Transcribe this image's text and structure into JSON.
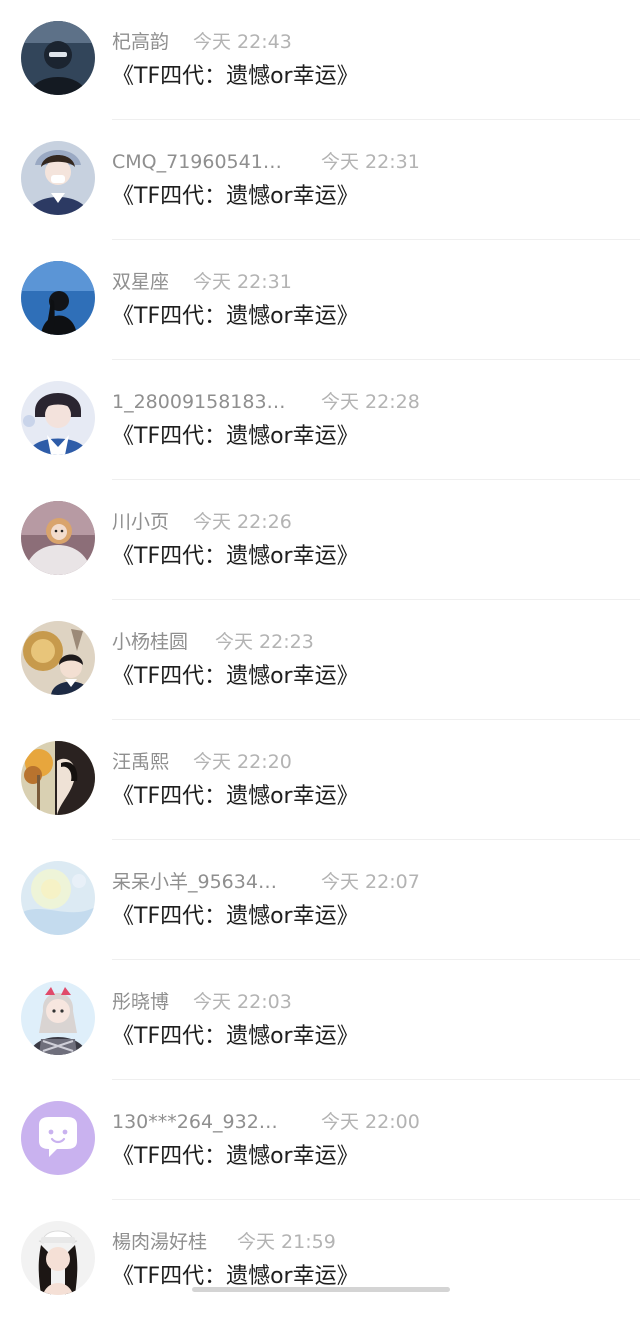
{
  "messages": [
    {
      "name": "杞高韵",
      "time": "今天 22:43",
      "text": "《TF四代：遗憾or幸运》",
      "avatar": "dark-masked-person"
    },
    {
      "name": "CMQ_71960541…",
      "time": "今天 22:31",
      "text": "《TF四代：遗憾or幸运》",
      "avatar": "girl-school-uniform"
    },
    {
      "name": "双星座",
      "time": "今天 22:31",
      "text": "《TF四代：遗憾or幸运》",
      "avatar": "silhouette-blue-sky"
    },
    {
      "name": "1_28009158183…",
      "time": "今天 22:28",
      "text": "《TF四代：遗憾or幸运》",
      "avatar": "boy-blue-white"
    },
    {
      "name": "川小页",
      "time": "今天 22:26",
      "text": "《TF四代：遗憾or幸运》",
      "avatar": "hooded-figure"
    },
    {
      "name": "小杨桂圆",
      "time": "今天 22:23",
      "text": "《TF四代：遗憾or幸运》",
      "avatar": "sun-drawing-boy"
    },
    {
      "name": "汪禹熙",
      "time": "今天 22:20",
      "text": "《TF四代：遗憾or幸运》",
      "avatar": "autumn-tree-girl"
    },
    {
      "name": "呆呆小羊_95634…",
      "time": "今天 22:07",
      "text": "《TF四代：遗憾or幸运》",
      "avatar": "pale-blue-pattern"
    },
    {
      "name": "彤晓博",
      "time": "今天 22:03",
      "text": "《TF四代：遗憾or幸运》",
      "avatar": "anime-girl-plaid"
    },
    {
      "name": "130***264_932…",
      "time": "今天 22:00",
      "text": "《TF四代：遗憾or幸运》",
      "avatar": "default-chat-bubble"
    },
    {
      "name": "楊肉湯好桂",
      "time": "今天 21:59",
      "text": "《TF四代：遗憾or幸运》",
      "avatar": "girl-white-cap"
    }
  ],
  "colors": {
    "name": "#8f8f8f",
    "time": "#b3b3b3",
    "message": "#1e1e1e",
    "divider": "#efefef",
    "default_avatar": "#c9b2ef"
  }
}
